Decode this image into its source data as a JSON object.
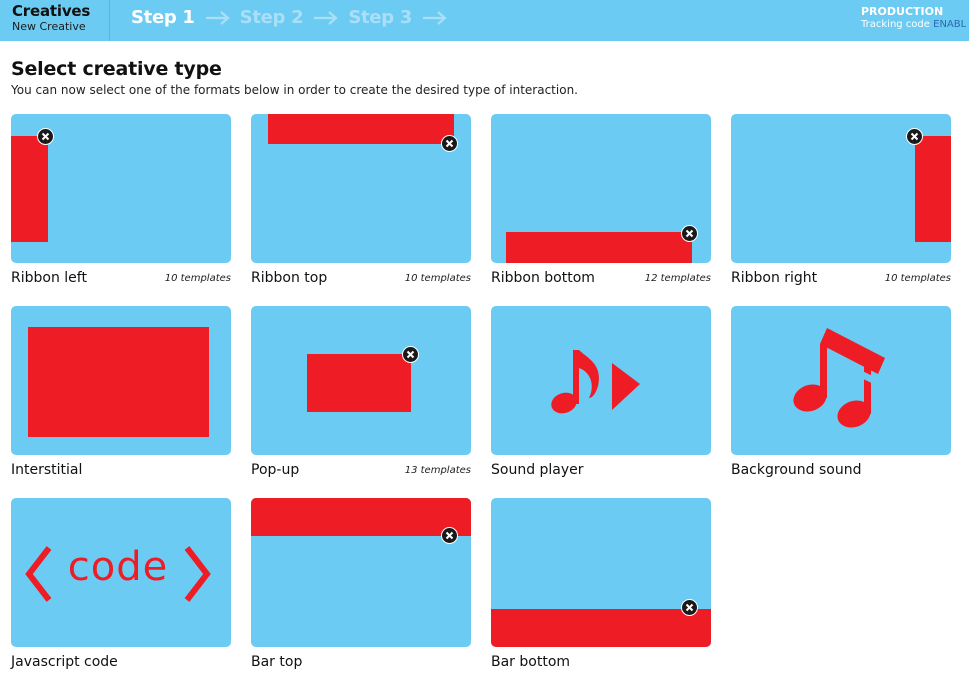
{
  "header": {
    "app_title": "Creatives",
    "app_subtitle": "New Creative",
    "steps": [
      "Step 1",
      "Step 2",
      "Step 3"
    ],
    "environment": "PRODUCTION",
    "tracking_label": "Tracking code",
    "tracking_status": "ENABL"
  },
  "page": {
    "title": "Select creative type",
    "subtitle": "You can now select one of the formats below in order to create the desired type of interaction."
  },
  "cards": [
    {
      "label": "Ribbon left",
      "count": "10 templates"
    },
    {
      "label": "Ribbon top",
      "count": "10 templates"
    },
    {
      "label": "Ribbon bottom",
      "count": "12 templates"
    },
    {
      "label": "Ribbon right",
      "count": "10 templates"
    },
    {
      "label": "Interstitial",
      "count": ""
    },
    {
      "label": "Pop-up",
      "count": "13 templates"
    },
    {
      "label": "Sound player",
      "count": ""
    },
    {
      "label": "Background sound",
      "count": ""
    },
    {
      "label": "Javascript code",
      "count": "",
      "thumb_text": "code"
    },
    {
      "label": "Bar top",
      "count": ""
    },
    {
      "label": "Bar bottom",
      "count": ""
    }
  ],
  "icons": {
    "close": "close-icon",
    "step_arrow": "arrow-right-icon",
    "sound_player": "music-note-play-icon",
    "background_sound": "double-music-note-icon",
    "code": "angle-brackets-icon"
  },
  "colors": {
    "header_bg": "#6ccbf2",
    "thumb_bg": "#6ccbf2",
    "accent_red": "#ee1c25",
    "step_active": "#ffffff",
    "step_inactive": "#aadff7"
  }
}
